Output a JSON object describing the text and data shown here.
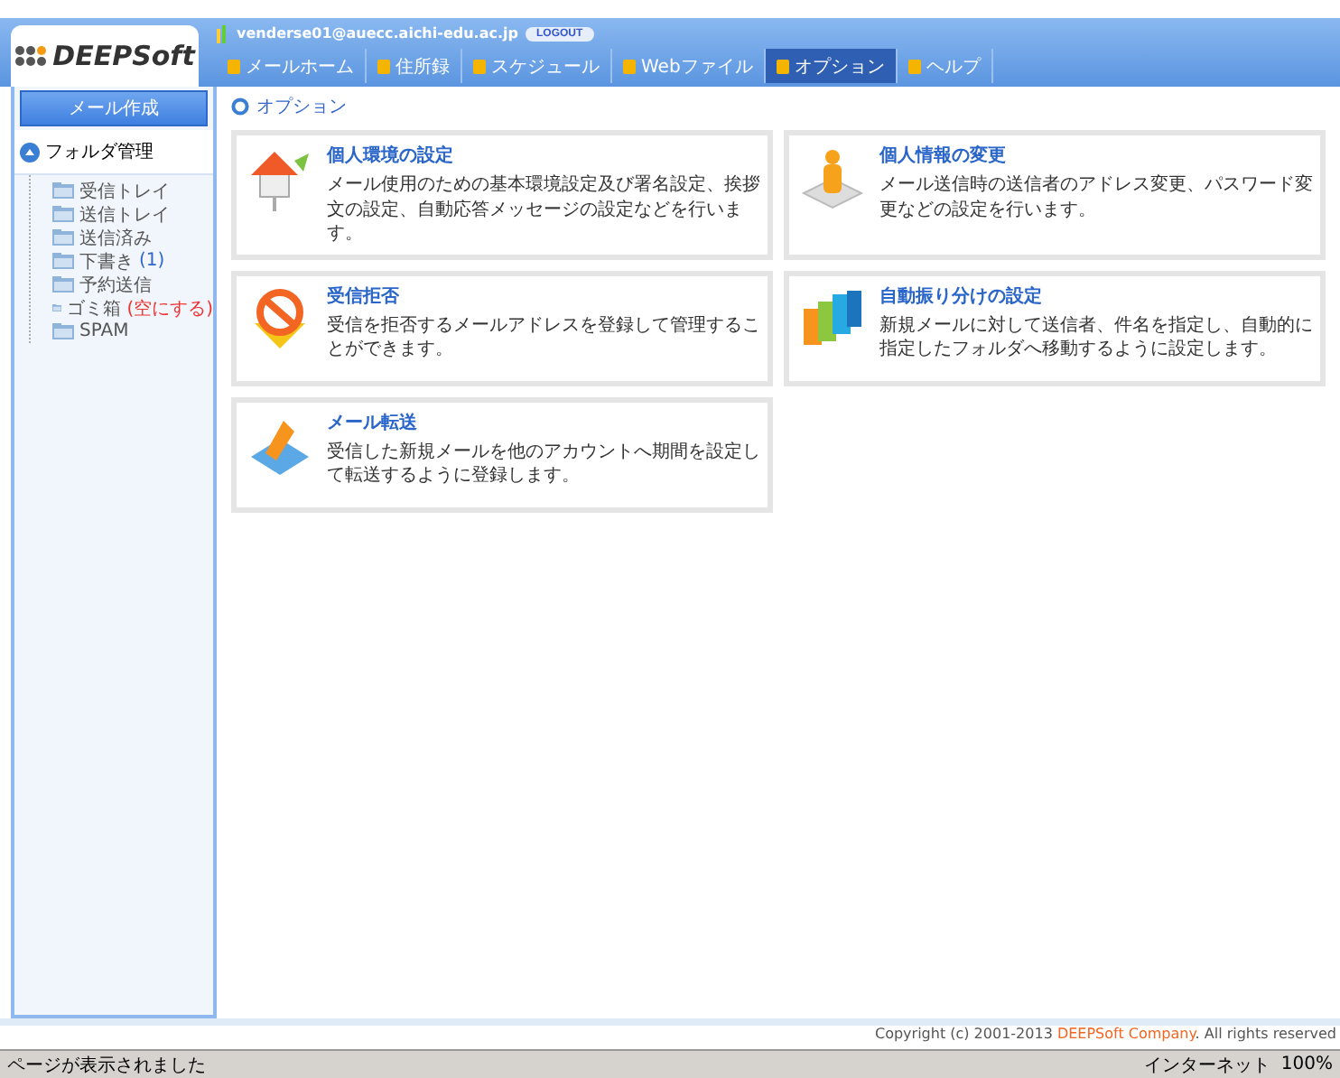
{
  "logo": {
    "text": "DEEPSoft"
  },
  "user": {
    "email": "venderse01@auecc.aichi-edu.ac.jp",
    "logout": "LOGOUT"
  },
  "tabs": [
    {
      "label": "メールホーム",
      "selected": false
    },
    {
      "label": "住所録",
      "selected": false
    },
    {
      "label": "スケジュール",
      "selected": false
    },
    {
      "label": "Webファイル",
      "selected": false
    },
    {
      "label": "オプション",
      "selected": true
    },
    {
      "label": "ヘルプ",
      "selected": false
    }
  ],
  "sidebar": {
    "compose_button": "メール作成",
    "folder_header": "フォルダ管理",
    "folders": [
      {
        "name": "受信トレイ"
      },
      {
        "name": "送信トレイ"
      },
      {
        "name": "送信済み"
      },
      {
        "name": "下書き",
        "count": "(1)"
      },
      {
        "name": "予約送信"
      },
      {
        "name": "ゴミ箱",
        "action": "(空にする)"
      },
      {
        "name": "SPAM"
      }
    ]
  },
  "page_title": "オプション",
  "cards": [
    {
      "kind": "house",
      "title": "個人環境の設定",
      "description": "メール使用のための基本環境設定及び署名設定、挨拶文の設定、自動応答メッセージの設定などを行います。"
    },
    {
      "kind": "person",
      "title": "個人情報の変更",
      "description": "メール送信時の送信者のアドレス変更、パスワード変更などの設定を行います。"
    },
    {
      "kind": "block",
      "title": "受信拒否",
      "description": "受信を拒否するメールアドレスを登録して管理することができます。"
    },
    {
      "kind": "folders",
      "title": "自動振り分けの設定",
      "description": "新規メールに対して送信者、件名を指定し、自動的に指定したフォルダへ移動するように設定します。"
    },
    {
      "kind": "forward",
      "title": "メール転送",
      "description": "受信した新規メールを他のアカウントへ期間を設定して転送するように登録します。"
    }
  ],
  "footer": [
    {
      "kind": "plain",
      "text": "Copyright (c) 2001-2013 "
    },
    {
      "kind": "brand",
      "text": "DEEPSoft Company"
    },
    {
      "kind": "plain",
      "text": ". All rights reserved"
    }
  ],
  "status_bar": {
    "message": "ページが表示されました",
    "zone": "インターネット",
    "zoom": "100%"
  }
}
